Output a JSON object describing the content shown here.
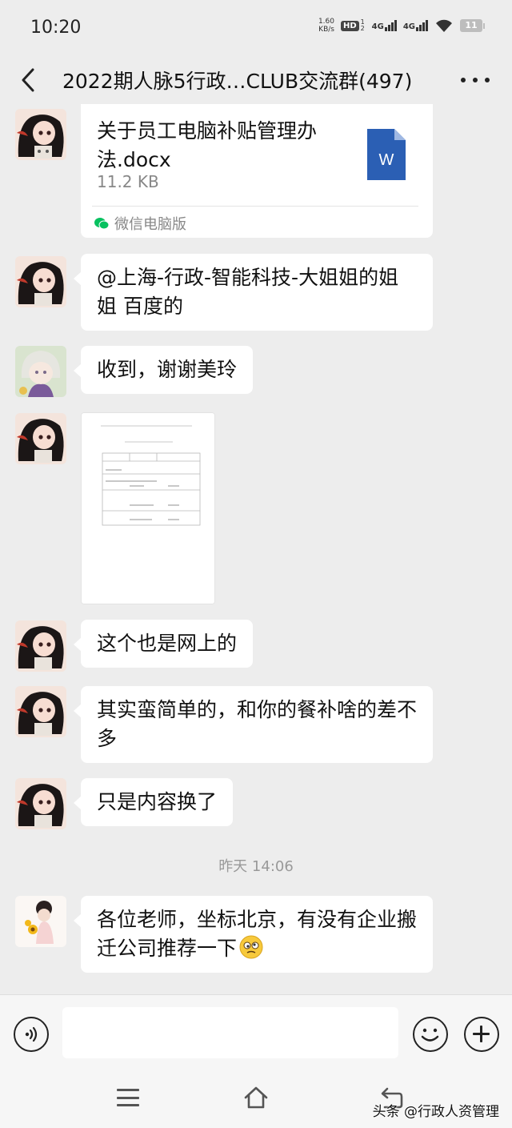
{
  "status_bar": {
    "time": "10:20",
    "net_speed_value": "1.60",
    "net_speed_unit": "KB/s",
    "hd_badge": "HD",
    "hd_sub": "1 2",
    "signal1_label": "4G",
    "signal2_label": "4G",
    "battery": "11"
  },
  "header": {
    "title": "2022期人脉5行政…CLUB交流群(497)"
  },
  "messages": {
    "file": {
      "file_name": "关于员工电脑补贴管理办法.docx",
      "file_size": "11.2 KB",
      "source": "微信电脑版",
      "word_letter": "W"
    },
    "text_2": "@上海-行政-智能科技-大姐姐的姐姐 百度的",
    "text_3": "收到，谢谢美玲",
    "text_5": "这个也是网上的",
    "text_6": "其实蛮简单的，和你的餐补啥的差不多",
    "text_7": "只是内容换了",
    "timestamp": "昨天 14:06",
    "text_8": "各位老师，坐标北京，有没有企业搬迁公司推荐一下"
  },
  "colors": {
    "background": "#ededed",
    "bubble": "#ffffff",
    "word_blue": "#2b5fb4",
    "wechat_green": "#07c160"
  },
  "watermark": "头条 @行政人资管理"
}
